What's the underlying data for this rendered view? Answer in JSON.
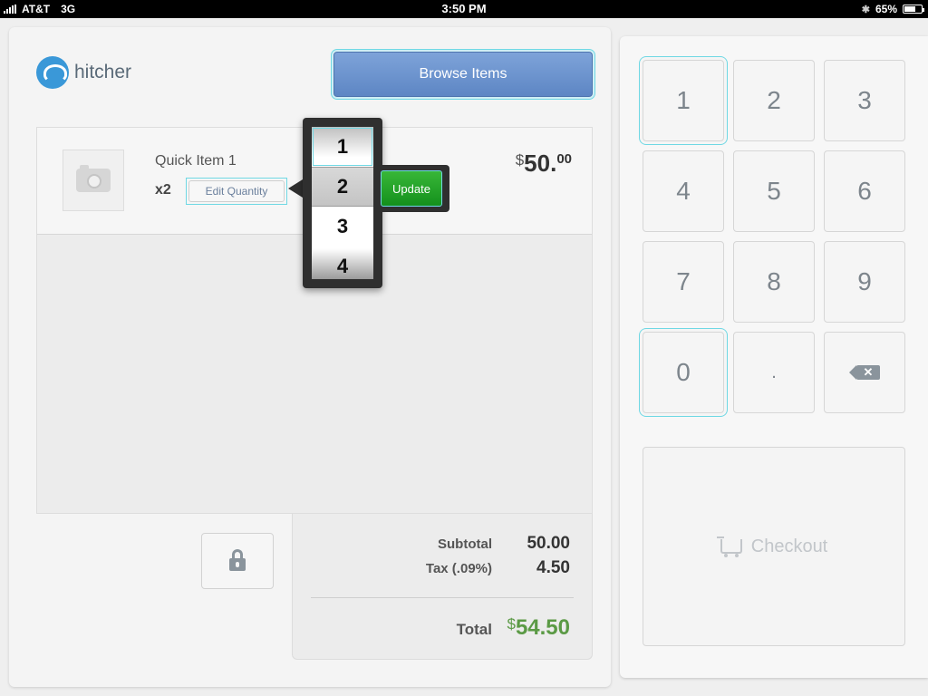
{
  "status_bar": {
    "carrier": "AT&T",
    "network": "3G",
    "time": "3:50 PM",
    "battery": "65%",
    "battery_level": 0.65,
    "bluetooth_icon": "bluetooth-icon"
  },
  "brand": {
    "name": "hitcher",
    "logo_color": "#3a98d8"
  },
  "header": {
    "browse_label": "Browse Items"
  },
  "cart": {
    "items": [
      {
        "name": "Quick Item 1",
        "qty": "x2",
        "edit_label": "Edit Quantity",
        "price_currency": "$",
        "price_whole": "50.",
        "price_cents": "00"
      }
    ]
  },
  "picker": {
    "options": [
      "1",
      "2",
      "3",
      "4"
    ],
    "selected": "2",
    "update_label": "Update"
  },
  "totals": {
    "subtotal_label": "Subtotal",
    "subtotal": "50.00",
    "tax_label": "Tax (.09%)",
    "tax": "4.50",
    "total_label": "Total",
    "total_currency": "$",
    "total": "54.50",
    "total_color": "#5b9a45"
  },
  "keypad": {
    "keys": [
      "1",
      "2",
      "3",
      "4",
      "5",
      "6",
      "7",
      "8",
      "9",
      "0",
      "."
    ],
    "checkout_label": "Checkout"
  },
  "colors": {
    "accent_blue": "#5d86c4",
    "update_green": "#14901c",
    "highlight": "#6fd8e4"
  }
}
